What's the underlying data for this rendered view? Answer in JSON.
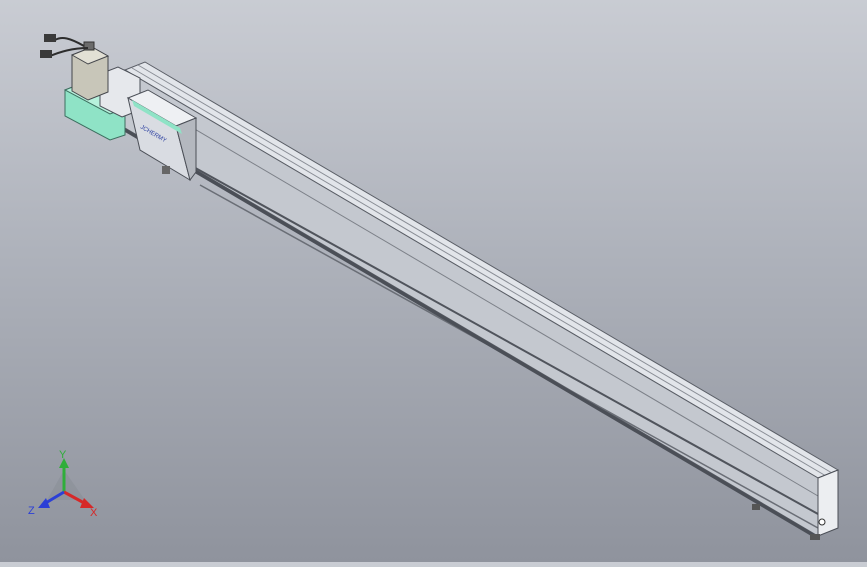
{
  "viewport": {
    "model": "linear-module-assembly"
  },
  "part_labels": {
    "carriage_logo": "JCHERMY"
  },
  "triad": {
    "x_label": "X",
    "y_label": "Y",
    "z_label": "Z",
    "colors": {
      "x": "#d62828",
      "y": "#2fae3a",
      "z": "#2b3fd6"
    }
  },
  "colors": {
    "rail_top": "#e2e5ea",
    "rail_side": "#bfc3ca",
    "rail_dark": "#6a6e76",
    "mount_block": "#8fe3c6",
    "motor": "#c8c6b9",
    "carriage": "#d9dce2"
  }
}
